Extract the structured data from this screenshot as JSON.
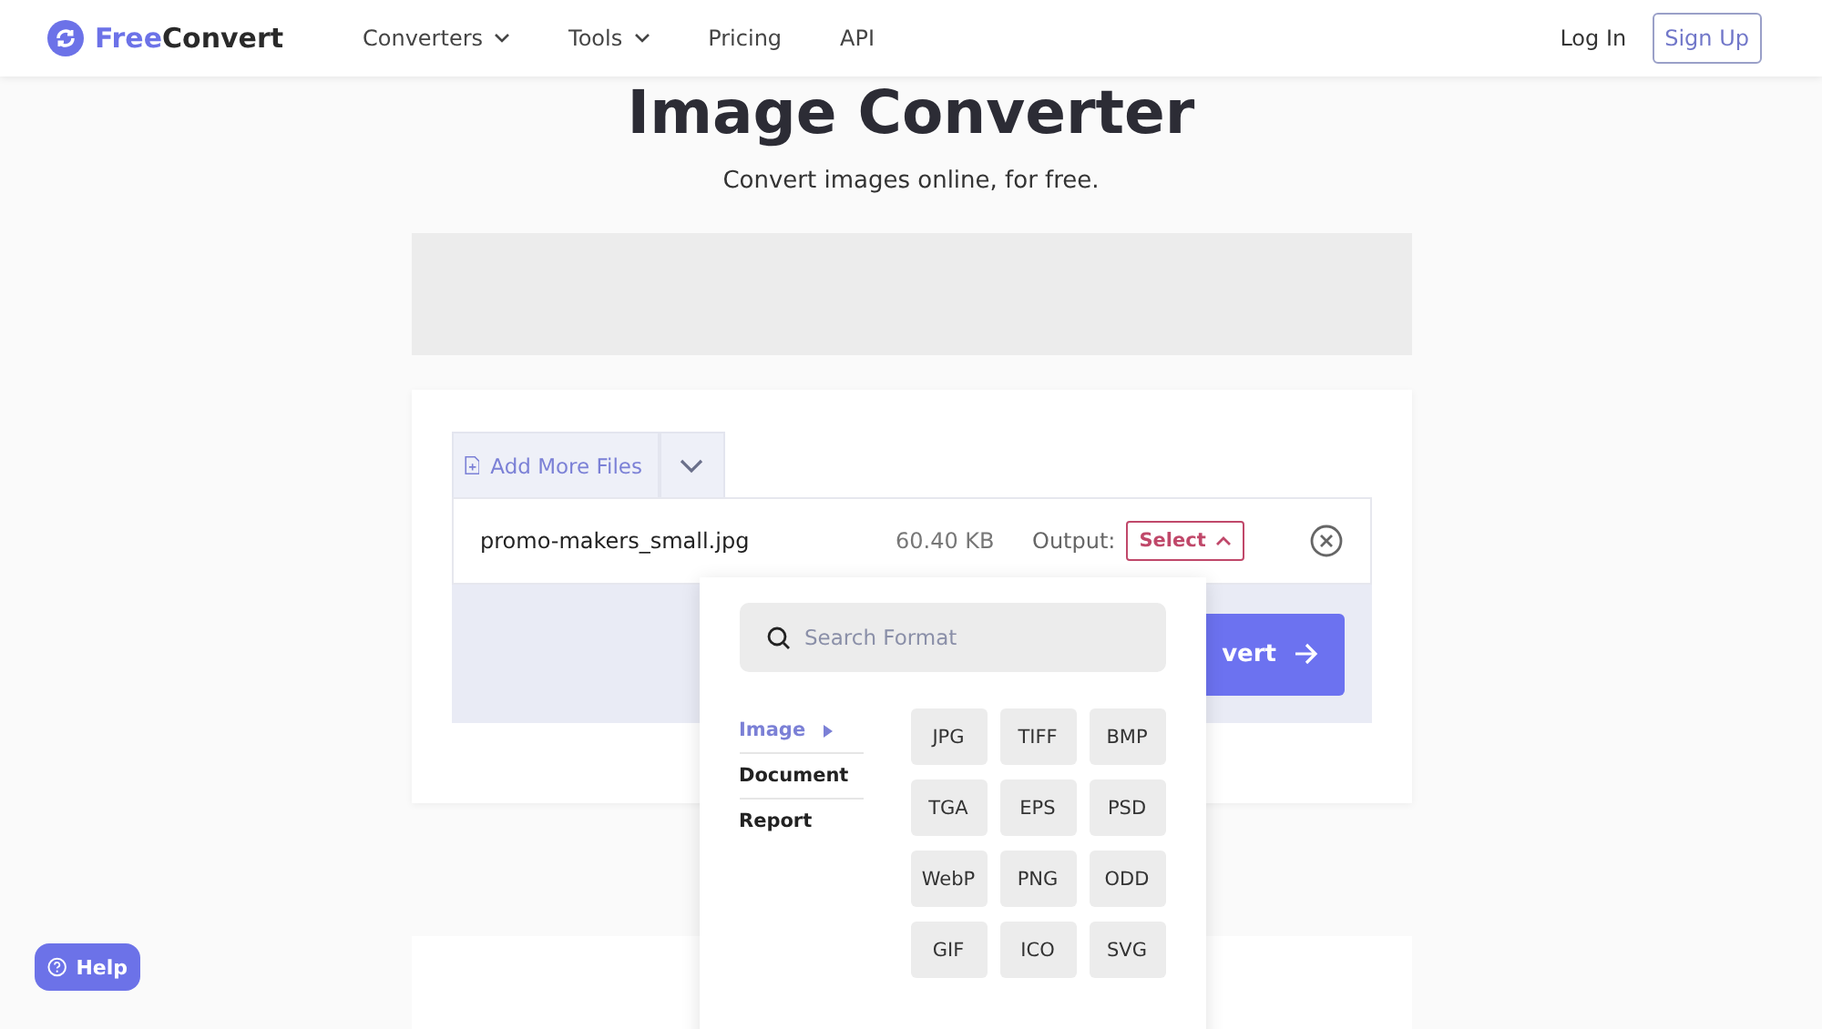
{
  "header": {
    "logo_text": {
      "light": "Free",
      "bold": "Convert"
    },
    "nav": [
      {
        "label": "Converters",
        "has_caret": true
      },
      {
        "label": "Tools",
        "has_caret": true
      },
      {
        "label": "Pricing",
        "has_caret": false
      },
      {
        "label": "API",
        "has_caret": false
      }
    ],
    "login": "Log In",
    "signup": "Sign Up"
  },
  "title": "Image Converter",
  "subtitle": "Convert images online, for free.",
  "uploader": {
    "add_more": "Add More Files",
    "file": {
      "name": "promo-makers_small.jpg",
      "size": "60.40 KB",
      "output_label": "Output:",
      "select": "Select",
      "select_open": true
    },
    "convert_button": "vert"
  },
  "dropdown": {
    "search_placeholder": "Search Format",
    "categories": [
      {
        "label": "Image",
        "selected": true
      },
      {
        "label": "Document",
        "selected": false
      },
      {
        "label": "Report",
        "selected": false
      }
    ],
    "formats": [
      "JPG",
      "TIFF",
      "BMP",
      "TGA",
      "EPS",
      "PSD",
      "WebP",
      "PNG",
      "ODD",
      "GIF",
      "ICO",
      "SVG"
    ]
  },
  "help": "Help"
}
